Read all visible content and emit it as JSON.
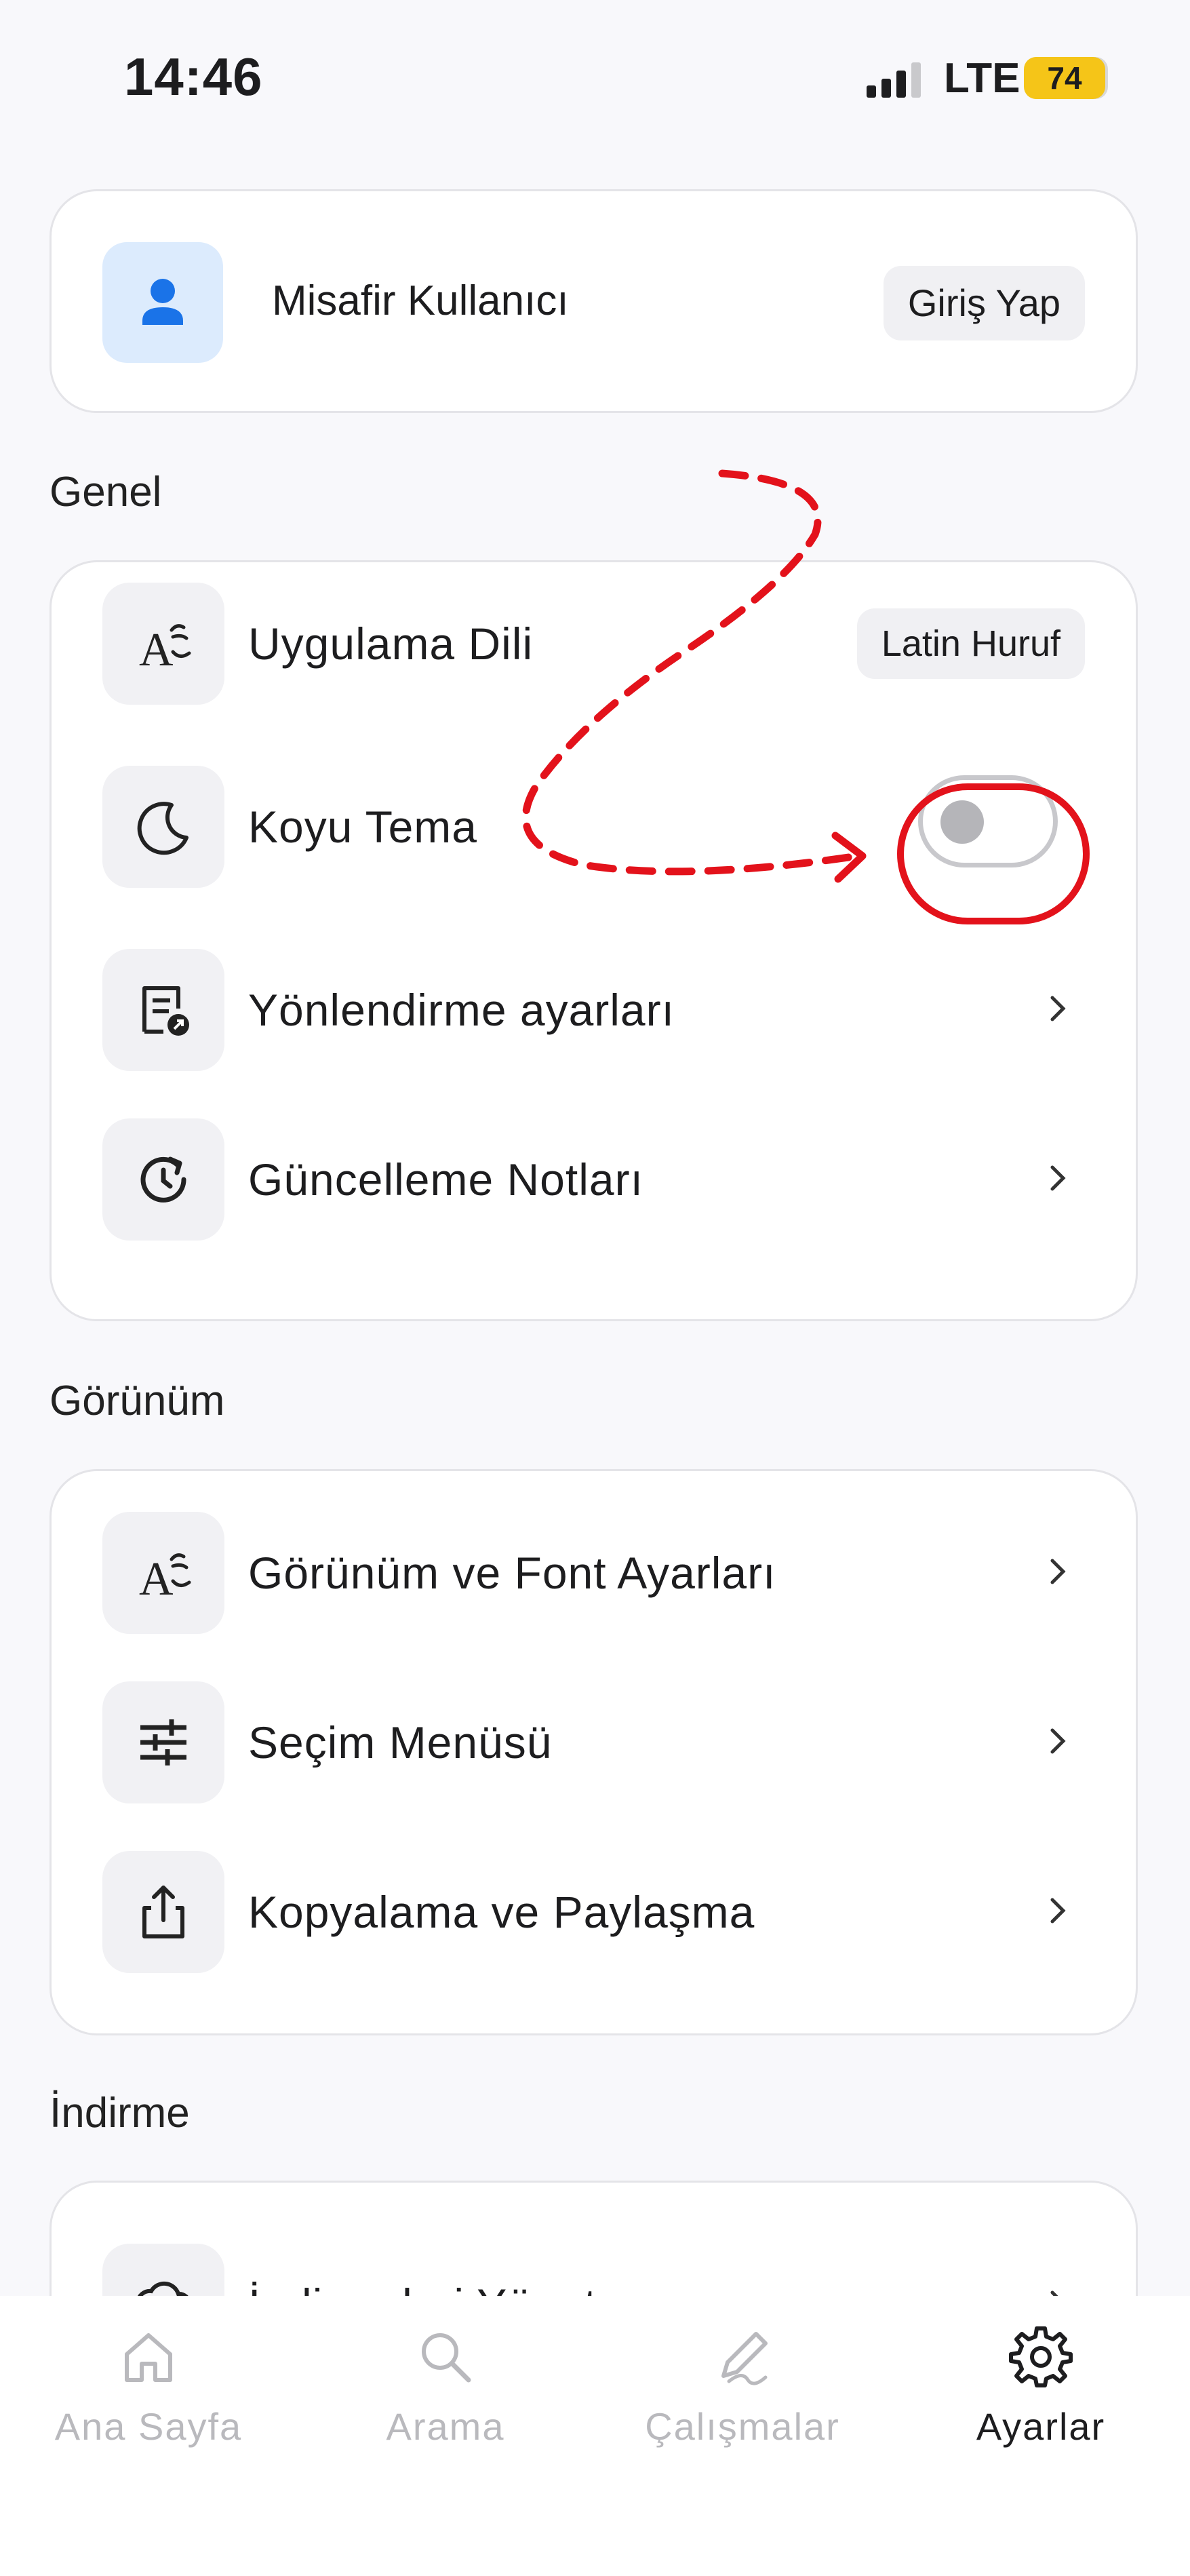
{
  "status_bar": {
    "time": "14:46",
    "network": "LTE",
    "battery": "74"
  },
  "profile": {
    "name": "Misafir Kullanıcı",
    "login_label": "Giriş Yap",
    "icon": "person-icon"
  },
  "sections": {
    "general": {
      "title": "Genel",
      "language": {
        "label": "Uygulama Dili",
        "value": "Latin Huruf",
        "icon": "language-icon"
      },
      "dark_theme": {
        "label": "Koyu Tema",
        "enabled": false,
        "icon": "moon-icon"
      },
      "routing": {
        "label": "Yönlendirme ayarları",
        "icon": "document-redirect-icon"
      },
      "updates": {
        "label": "Güncelleme Notları",
        "icon": "history-icon"
      }
    },
    "appearance": {
      "title": "Görünüm",
      "font": {
        "label": "Görünüm ve Font Ayarları",
        "icon": "language-icon"
      },
      "selection_menu": {
        "label": "Seçim Menüsü",
        "icon": "sliders-icon"
      },
      "copy_share": {
        "label": "Kopyalama ve Paylaşma",
        "icon": "share-icon"
      }
    },
    "download": {
      "title": "İndirme",
      "manage": {
        "label": "İndirmeleri Yönet",
        "icon": "download-cloud-icon"
      }
    }
  },
  "tabbar": {
    "home": "Ana Sayfa",
    "search": "Arama",
    "studies": "Çalışmalar",
    "settings": "Ayarlar",
    "active": "settings"
  },
  "colors": {
    "accent_blue": "#1a73e8",
    "annotation_red": "#e3121b",
    "battery": "#f5c518"
  }
}
